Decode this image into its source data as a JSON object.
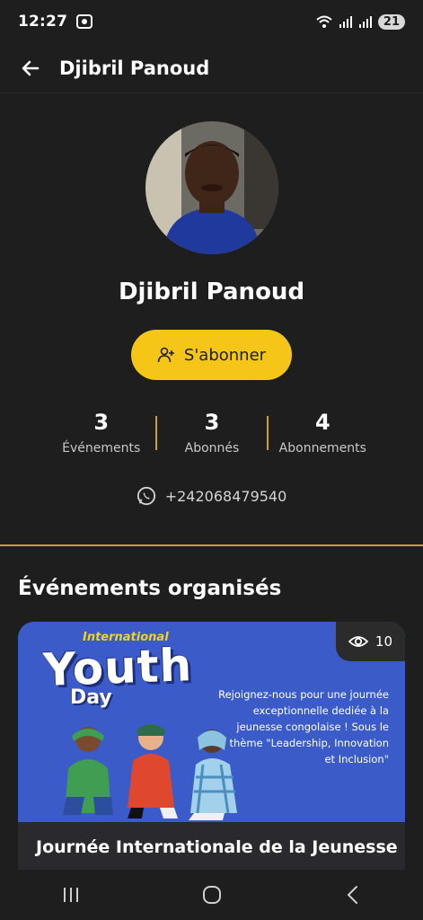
{
  "status_bar": {
    "time": "12:27",
    "battery": "21"
  },
  "app_bar": {
    "title": "Djibril Panoud"
  },
  "profile": {
    "name": "Djibril Panoud",
    "subscribe_label": "S'abonner",
    "phone": "+242068479540"
  },
  "stats": [
    {
      "value": "3",
      "label": "Événements"
    },
    {
      "value": "3",
      "label": "Abonnés"
    },
    {
      "value": "4",
      "label": "Abonnements"
    }
  ],
  "section": {
    "title": "Événements organisés"
  },
  "event": {
    "views": "10",
    "banner_small": "International",
    "banner_main": "Youth",
    "banner_day": "Day",
    "banner_desc": "Rejoignez-nous pour une journée exceptionnelle dediée à la jeunesse congolaise ! Sous le thème \"Leadership, Innovation et Inclusion\"",
    "title": "Journée Internationale de la Jeunesse"
  },
  "colors": {
    "background": "#1e1e1e",
    "accent": "#f5c518",
    "divider": "#c9a227",
    "banner": "#3b5cc8"
  }
}
